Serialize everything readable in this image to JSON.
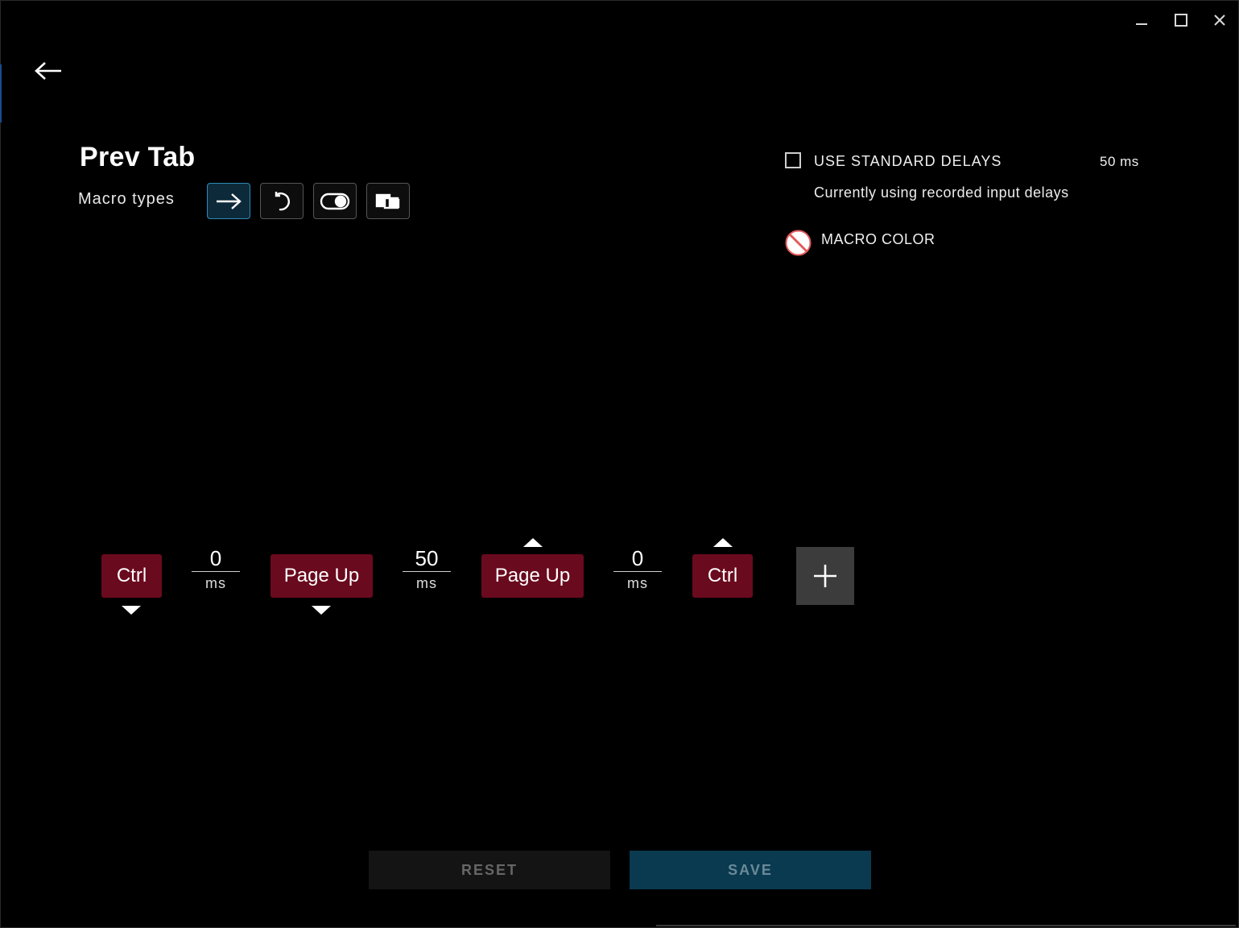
{
  "window": {
    "controls": [
      "minimize-icon",
      "maximize-icon",
      "close-icon"
    ]
  },
  "header": {
    "back_icon": "arrow-left-icon",
    "title": "Prev Tab"
  },
  "macro_types": {
    "label": "Macro types",
    "options": [
      {
        "icon": "arrow-right-icon",
        "active": true
      },
      {
        "icon": "repeat-icon",
        "active": false
      },
      {
        "icon": "toggle-icon",
        "active": false
      },
      {
        "icon": "sequence-icon",
        "active": false
      }
    ]
  },
  "settings": {
    "standard_delays_label": "USE STANDARD DELAYS",
    "standard_delays_checked": false,
    "standard_delays_value": "50 ms",
    "delay_status": "Currently using recorded input delays",
    "macro_color_label": "MACRO COLOR",
    "macro_color_icon": "no-color-icon"
  },
  "sequence": {
    "keys": [
      {
        "label": "Ctrl",
        "action": "press"
      },
      {
        "label": "Page Up",
        "action": "press"
      },
      {
        "label": "Page Up",
        "action": "release"
      },
      {
        "label": "Ctrl",
        "action": "release"
      }
    ],
    "delays": [
      {
        "value": "0",
        "unit": "ms"
      },
      {
        "value": "50",
        "unit": "ms"
      },
      {
        "value": "0",
        "unit": "ms"
      }
    ],
    "add_icon": "plus-icon"
  },
  "footer": {
    "reset_label": "RESET",
    "save_label": "SAVE"
  },
  "colors": {
    "key_bg": "#6a0a1e",
    "accent": "#2d8ab8",
    "save_bg": "#0a3a50"
  }
}
